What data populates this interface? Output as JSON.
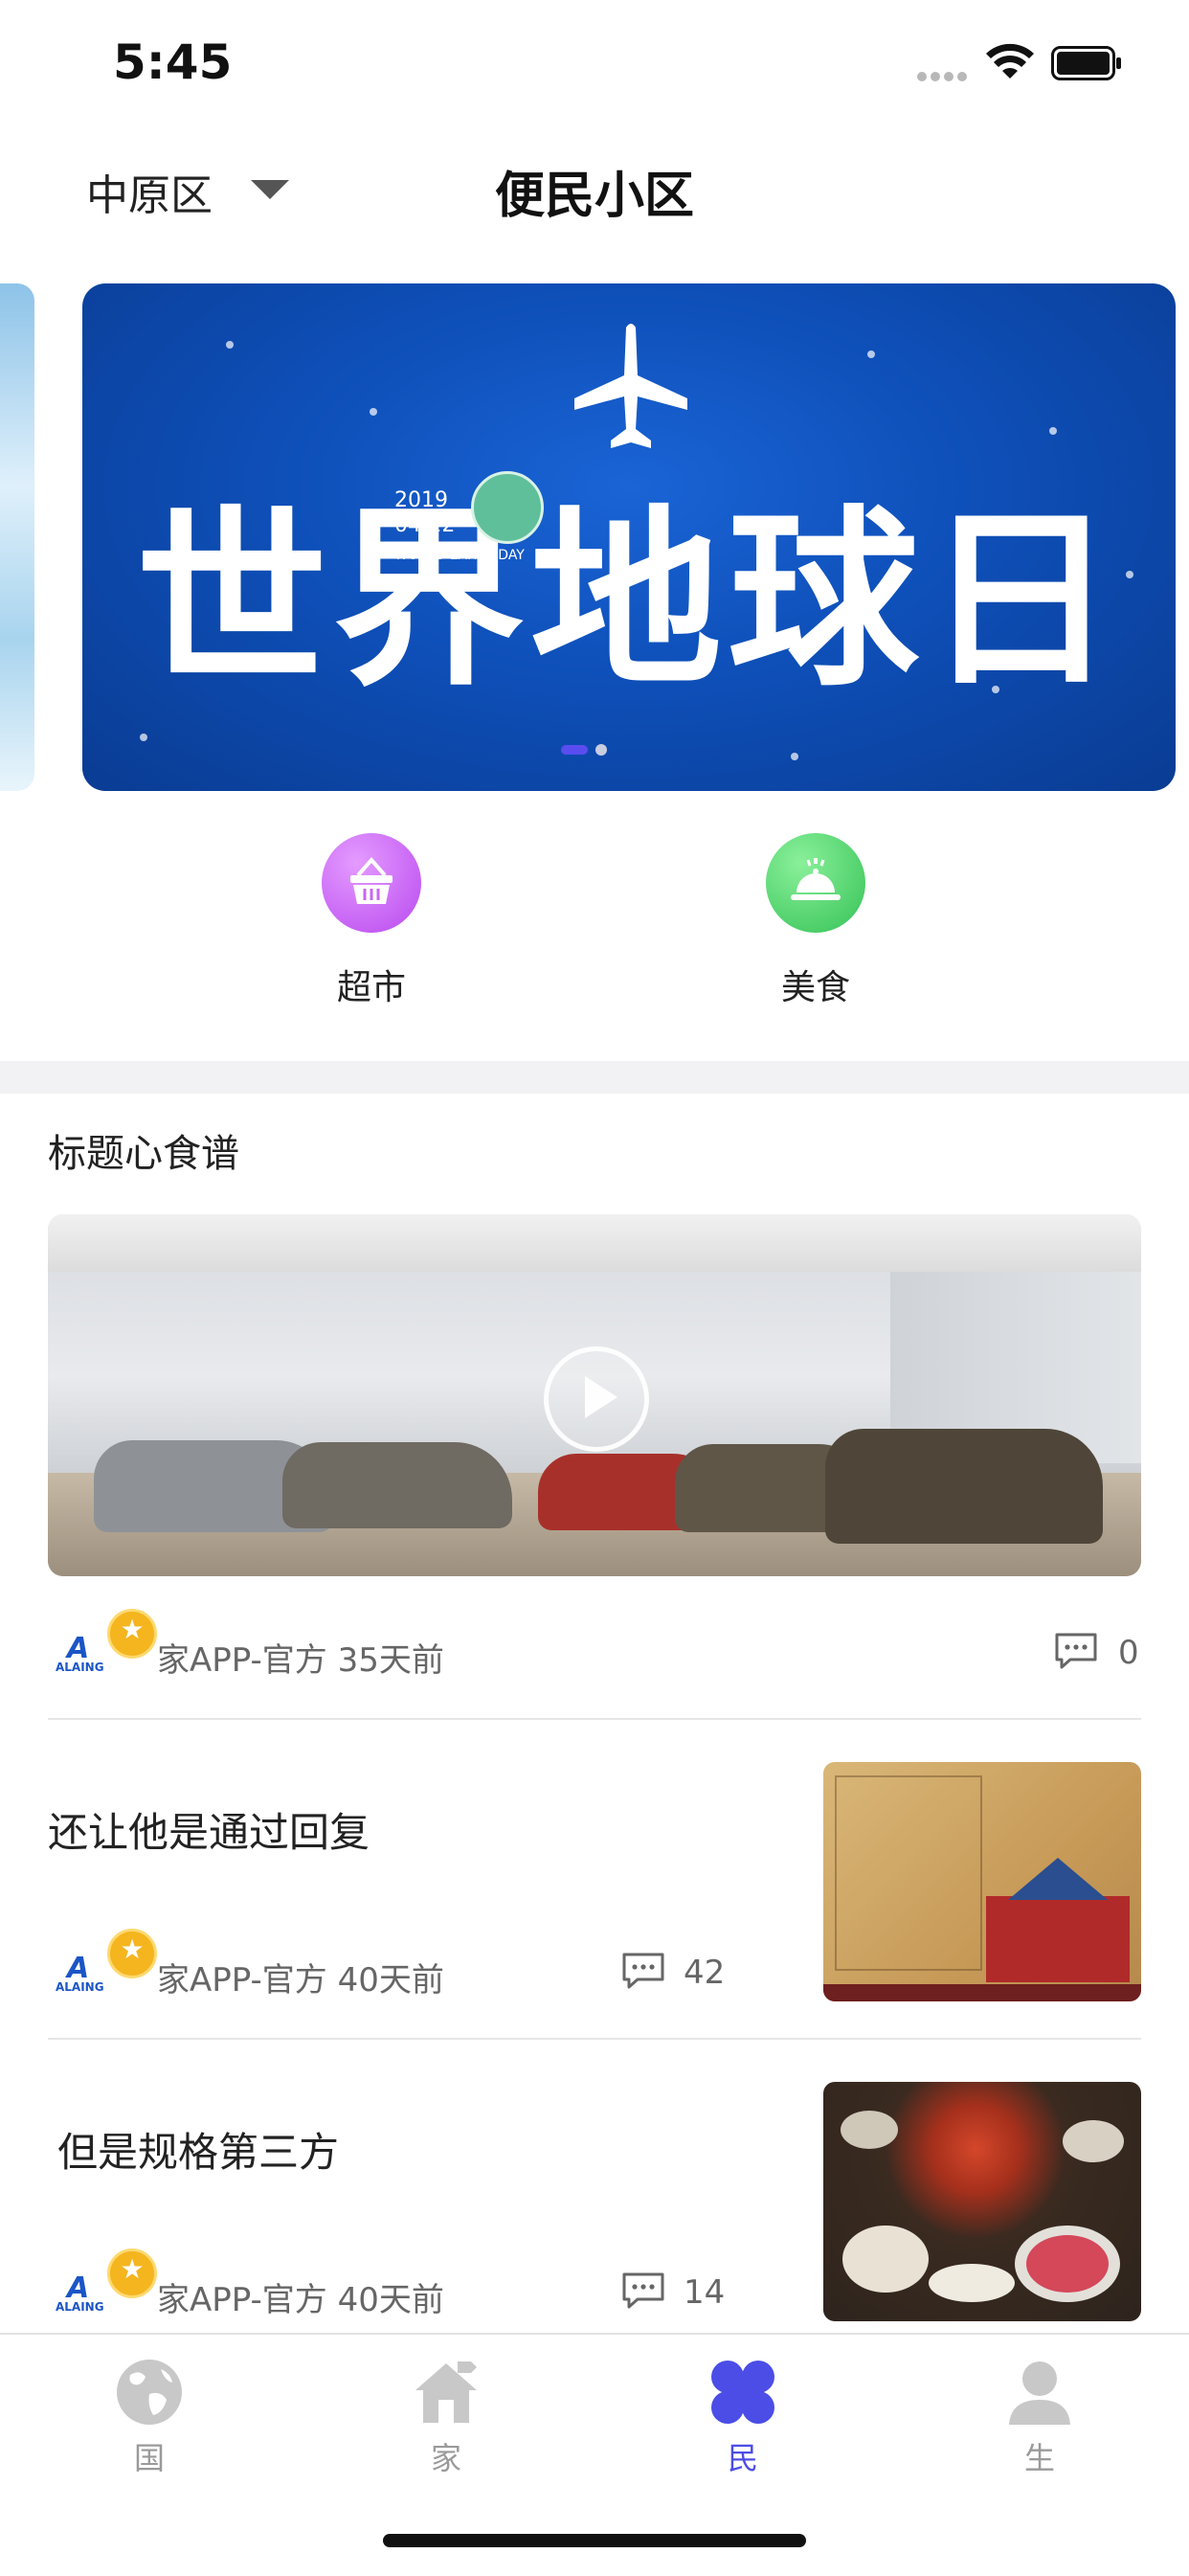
{
  "status_bar": {
    "time": "5:45"
  },
  "header": {
    "district": "中原区",
    "title": "便民小区"
  },
  "banner": {
    "headline": "世界地球日",
    "badge_year": "2019",
    "badge_date": "04/22",
    "badge_caption": "WORLD EARTH DAY",
    "active_index": 0,
    "count": 2
  },
  "categories": [
    {
      "label": "超市",
      "icon": "basket-icon",
      "color": "#c867f2"
    },
    {
      "label": "美食",
      "icon": "cloche-icon",
      "color": "#4fd16e"
    }
  ],
  "section": {
    "title": "标题心食谱"
  },
  "video_post": {
    "author_time": "家APP-官方 35天前",
    "comments": "0"
  },
  "articles": [
    {
      "title": "还让他是通过回复",
      "author_time": "家APP-官方 40天前",
      "comments": "42"
    },
    {
      "title": "但是规格第三方",
      "author_time": "家APP-官方 40天前",
      "comments": "14"
    }
  ],
  "avatar_text": {
    "logo": "A",
    "name": "ALAING"
  },
  "tabbar": [
    {
      "label": "国",
      "icon": "globe-icon",
      "active": false
    },
    {
      "label": "家",
      "icon": "house-icon",
      "active": false
    },
    {
      "label": "民",
      "icon": "clover-icon",
      "active": true
    },
    {
      "label": "生",
      "icon": "person-icon",
      "active": false
    }
  ],
  "colors": {
    "accent": "#4b4de6",
    "banner_blue": "#0e4fb8",
    "badge_gold": "#f5b51f"
  }
}
